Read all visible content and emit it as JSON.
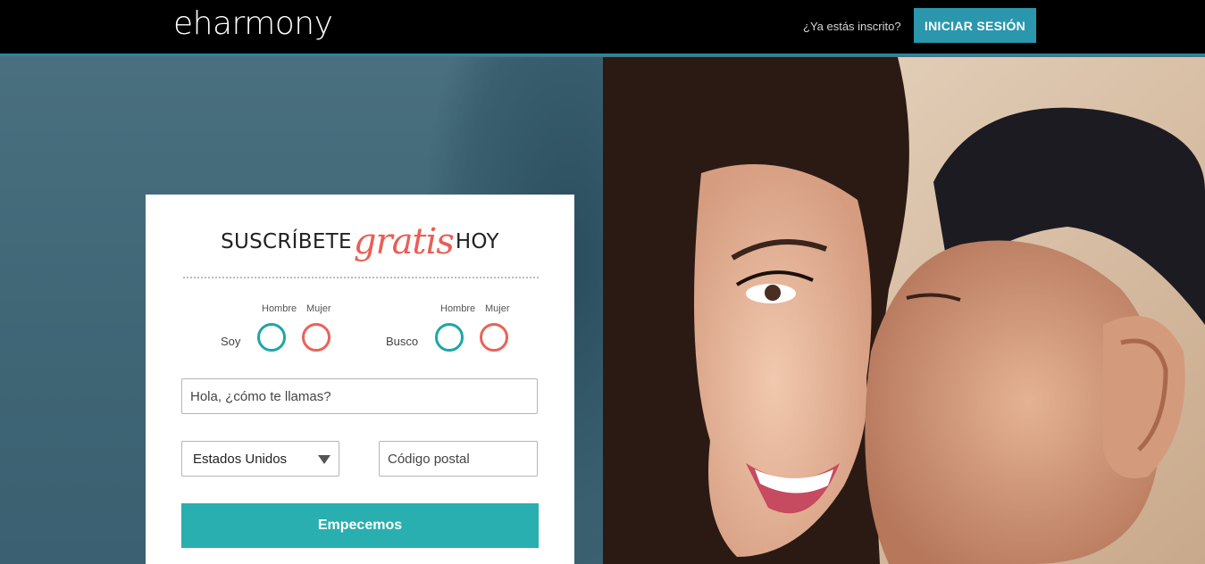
{
  "header": {
    "logo": "eharmony",
    "already_registered": "¿Ya estás inscrito?",
    "login_label": "INICIAR SESIÓN"
  },
  "signup": {
    "headline_pre": "SUSCRÍBETE",
    "headline_script": "gratis",
    "headline_post": "HOY",
    "soy": {
      "label": "Soy",
      "male_label": "Hombre",
      "female_label": "Mujer"
    },
    "busco": {
      "label": "Busco",
      "male_label": "Hombre",
      "female_label": "Mujer"
    },
    "name_placeholder": "Hola, ¿cómo te llamas?",
    "country_value": "Estados Unidos",
    "zip_placeholder": "Código postal",
    "submit_label": "Empecemos"
  },
  "colors": {
    "header_bg": "#000000",
    "login_button": "#2a97ad",
    "male_circle": "#1ea6a6",
    "female_circle": "#e9625a",
    "cta_button": "#29afaf",
    "accent_script": "#ea5e55"
  }
}
